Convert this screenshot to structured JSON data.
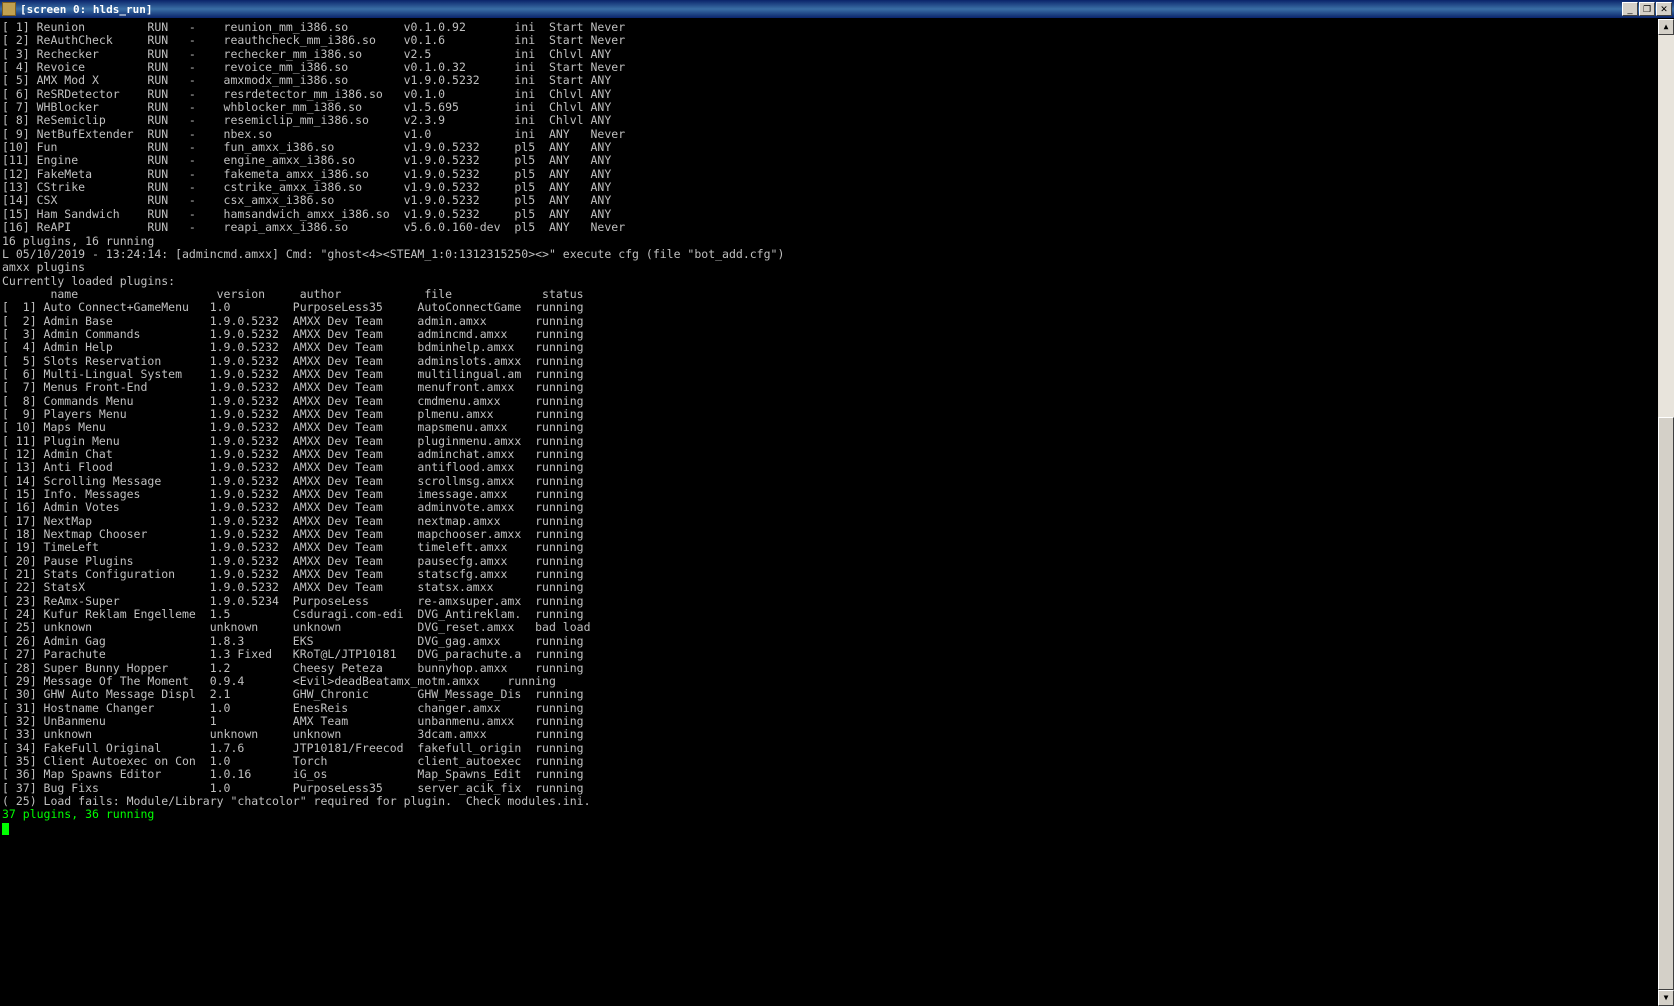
{
  "window": {
    "title": "[screen 0: hlds_run]"
  },
  "meta_list": [
    {
      "idx": " 1",
      "name": "Reunion",
      "stat": "RUN",
      "dash": "-",
      "file": "reunion_mm_i386.so",
      "ver": "v0.1.0.92",
      "src": "ini",
      "load": "Start",
      "unl": "Never"
    },
    {
      "idx": " 2",
      "name": "ReAuthCheck",
      "stat": "RUN",
      "dash": "-",
      "file": "reauthcheck_mm_i386.so",
      "ver": "v0.1.6",
      "src": "ini",
      "load": "Start",
      "unl": "Never"
    },
    {
      "idx": " 3",
      "name": "Rechecker",
      "stat": "RUN",
      "dash": "-",
      "file": "rechecker_mm_i386.so",
      "ver": "v2.5",
      "src": "ini",
      "load": "Chlvl",
      "unl": "ANY"
    },
    {
      "idx": " 4",
      "name": "Revoice",
      "stat": "RUN",
      "dash": "-",
      "file": "revoice_mm_i386.so",
      "ver": "v0.1.0.32",
      "src": "ini",
      "load": "Start",
      "unl": "Never"
    },
    {
      "idx": " 5",
      "name": "AMX Mod X",
      "stat": "RUN",
      "dash": "-",
      "file": "amxmodx_mm_i386.so",
      "ver": "v1.9.0.5232",
      "src": "ini",
      "load": "Start",
      "unl": "ANY"
    },
    {
      "idx": " 6",
      "name": "ReSRDetector",
      "stat": "RUN",
      "dash": "-",
      "file": "resrdetector_mm_i386.so",
      "ver": "v0.1.0",
      "src": "ini",
      "load": "Chlvl",
      "unl": "ANY"
    },
    {
      "idx": " 7",
      "name": "WHBlocker",
      "stat": "RUN",
      "dash": "-",
      "file": "whblocker_mm_i386.so",
      "ver": "v1.5.695",
      "src": "ini",
      "load": "Chlvl",
      "unl": "ANY"
    },
    {
      "idx": " 8",
      "name": "ReSemiclip",
      "stat": "RUN",
      "dash": "-",
      "file": "resemiclip_mm_i386.so",
      "ver": "v2.3.9",
      "src": "ini",
      "load": "Chlvl",
      "unl": "ANY"
    },
    {
      "idx": " 9",
      "name": "NetBufExtender",
      "stat": "RUN",
      "dash": "-",
      "file": "nbex.so",
      "ver": "v1.0",
      "src": "ini",
      "load": "ANY",
      "unl": "Never"
    },
    {
      "idx": "10",
      "name": "Fun",
      "stat": "RUN",
      "dash": "-",
      "file": "fun_amxx_i386.so",
      "ver": "v1.9.0.5232",
      "src": "pl5",
      "load": "ANY",
      "unl": "ANY"
    },
    {
      "idx": "11",
      "name": "Engine",
      "stat": "RUN",
      "dash": "-",
      "file": "engine_amxx_i386.so",
      "ver": "v1.9.0.5232",
      "src": "pl5",
      "load": "ANY",
      "unl": "ANY"
    },
    {
      "idx": "12",
      "name": "FakeMeta",
      "stat": "RUN",
      "dash": "-",
      "file": "fakemeta_amxx_i386.so",
      "ver": "v1.9.0.5232",
      "src": "pl5",
      "load": "ANY",
      "unl": "ANY"
    },
    {
      "idx": "13",
      "name": "CStrike",
      "stat": "RUN",
      "dash": "-",
      "file": "cstrike_amxx_i386.so",
      "ver": "v1.9.0.5232",
      "src": "pl5",
      "load": "ANY",
      "unl": "ANY"
    },
    {
      "idx": "14",
      "name": "CSX",
      "stat": "RUN",
      "dash": "-",
      "file": "csx_amxx_i386.so",
      "ver": "v1.9.0.5232",
      "src": "pl5",
      "load": "ANY",
      "unl": "ANY"
    },
    {
      "idx": "15",
      "name": "Ham Sandwich",
      "stat": "RUN",
      "dash": "-",
      "file": "hamsandwich_amxx_i386.so",
      "ver": "v1.9.0.5232",
      "src": "pl5",
      "load": "ANY",
      "unl": "ANY"
    },
    {
      "idx": "16",
      "name": "ReAPI",
      "stat": "RUN",
      "dash": "-",
      "file": "reapi_amxx_i386.so",
      "ver": "v5.6.0.160-dev",
      "src": "pl5",
      "load": "ANY",
      "unl": "Never"
    }
  ],
  "meta_summary": "16 plugins, 16 running",
  "log_line": "L 05/10/2019 - 13:24:14: [admincmd.amxx] Cmd: \"ghost<4><STEAM_1:0:1312315250><>\" execute cfg (file \"bot_add.cfg\")",
  "amxx_cmd": "amxx plugins",
  "amxx_loaded": "Currently loaded plugins:",
  "amxx_header": {
    "name": "name",
    "version": "version",
    "author": "author",
    "file": "file",
    "status": "status"
  },
  "amxx_list": [
    {
      "idx": "  1",
      "name": "Auto Connect+GameMenu",
      "ver": "1.0",
      "author": "PurposeLess35",
      "file": "AutoConnectGame",
      "status": "running"
    },
    {
      "idx": "  2",
      "name": "Admin Base",
      "ver": "1.9.0.5232",
      "author": "AMXX Dev Team",
      "file": "admin.amxx",
      "status": "running"
    },
    {
      "idx": "  3",
      "name": "Admin Commands",
      "ver": "1.9.0.5232",
      "author": "AMXX Dev Team",
      "file": "admincmd.amxx",
      "status": "running"
    },
    {
      "idx": "  4",
      "name": "Admin Help",
      "ver": "1.9.0.5232",
      "author": "AMXX Dev Team",
      "file": "bdminhelp.amxx",
      "status": "running"
    },
    {
      "idx": "  5",
      "name": "Slots Reservation",
      "ver": "1.9.0.5232",
      "author": "AMXX Dev Team",
      "file": "adminslots.amxx",
      "status": "running"
    },
    {
      "idx": "  6",
      "name": "Multi-Lingual System",
      "ver": "1.9.0.5232",
      "author": "AMXX Dev Team",
      "file": "multilingual.am",
      "status": "running"
    },
    {
      "idx": "  7",
      "name": "Menus Front-End",
      "ver": "1.9.0.5232",
      "author": "AMXX Dev Team",
      "file": "menufront.amxx",
      "status": "running"
    },
    {
      "idx": "  8",
      "name": "Commands Menu",
      "ver": "1.9.0.5232",
      "author": "AMXX Dev Team",
      "file": "cmdmenu.amxx",
      "status": "running"
    },
    {
      "idx": "  9",
      "name": "Players Menu",
      "ver": "1.9.0.5232",
      "author": "AMXX Dev Team",
      "file": "plmenu.amxx",
      "status": "running"
    },
    {
      "idx": " 10",
      "name": "Maps Menu",
      "ver": "1.9.0.5232",
      "author": "AMXX Dev Team",
      "file": "mapsmenu.amxx",
      "status": "running"
    },
    {
      "idx": " 11",
      "name": "Plugin Menu",
      "ver": "1.9.0.5232",
      "author": "AMXX Dev Team",
      "file": "pluginmenu.amxx",
      "status": "running"
    },
    {
      "idx": " 12",
      "name": "Admin Chat",
      "ver": "1.9.0.5232",
      "author": "AMXX Dev Team",
      "file": "adminchat.amxx",
      "status": "running"
    },
    {
      "idx": " 13",
      "name": "Anti Flood",
      "ver": "1.9.0.5232",
      "author": "AMXX Dev Team",
      "file": "antiflood.amxx",
      "status": "running"
    },
    {
      "idx": " 14",
      "name": "Scrolling Message",
      "ver": "1.9.0.5232",
      "author": "AMXX Dev Team",
      "file": "scrollmsg.amxx",
      "status": "running"
    },
    {
      "idx": " 15",
      "name": "Info. Messages",
      "ver": "1.9.0.5232",
      "author": "AMXX Dev Team",
      "file": "imessage.amxx",
      "status": "running"
    },
    {
      "idx": " 16",
      "name": "Admin Votes",
      "ver": "1.9.0.5232",
      "author": "AMXX Dev Team",
      "file": "adminvote.amxx",
      "status": "running"
    },
    {
      "idx": " 17",
      "name": "NextMap",
      "ver": "1.9.0.5232",
      "author": "AMXX Dev Team",
      "file": "nextmap.amxx",
      "status": "running"
    },
    {
      "idx": " 18",
      "name": "Nextmap Chooser",
      "ver": "1.9.0.5232",
      "author": "AMXX Dev Team",
      "file": "mapchooser.amxx",
      "status": "running"
    },
    {
      "idx": " 19",
      "name": "TimeLeft",
      "ver": "1.9.0.5232",
      "author": "AMXX Dev Team",
      "file": "timeleft.amxx",
      "status": "running"
    },
    {
      "idx": " 20",
      "name": "Pause Plugins",
      "ver": "1.9.0.5232",
      "author": "AMXX Dev Team",
      "file": "pausecfg.amxx",
      "status": "running"
    },
    {
      "idx": " 21",
      "name": "Stats Configuration",
      "ver": "1.9.0.5232",
      "author": "AMXX Dev Team",
      "file": "statscfg.amxx",
      "status": "running"
    },
    {
      "idx": " 22",
      "name": "StatsX",
      "ver": "1.9.0.5232",
      "author": "AMXX Dev Team",
      "file": "statsx.amxx",
      "status": "running"
    },
    {
      "idx": " 23",
      "name": "ReAmx-Super",
      "ver": "1.9.0.5234",
      "author": "PurposeLess",
      "file": "re-amxsuper.amx",
      "status": "running"
    },
    {
      "idx": " 24",
      "name": "Kufur Reklam Engelleme",
      "ver": "1.5",
      "author": "Csduragi.com-edi",
      "file": "DVG_Antireklam.",
      "status": "running"
    },
    {
      "idx": " 25",
      "name": "unknown",
      "ver": "unknown",
      "author": "unknown",
      "file": "DVG_reset.amxx",
      "status": "bad load"
    },
    {
      "idx": " 26",
      "name": "Admin Gag",
      "ver": "1.8.3",
      "author": "EKS",
      "file": "DVG_gag.amxx",
      "status": "running"
    },
    {
      "idx": " 27",
      "name": "Parachute",
      "ver": "1.3 Fixed",
      "author": "KRoT@L/JTP10181",
      "file": "DVG_parachute.a",
      "status": "running"
    },
    {
      "idx": " 28",
      "name": "Super Bunny Hopper",
      "ver": "1.2",
      "author": "Cheesy Peteza",
      "file": "bunnyhop.amxx",
      "status": "running"
    },
    {
      "idx": " 29",
      "name": "Message Of The Moment",
      "ver": "0.9.4",
      "author": "<Evil>deadBeat",
      "file": "amx_motm.amxx",
      "status": "running"
    },
    {
      "idx": " 30",
      "name": "GHW Auto Message Displ",
      "ver": "2.1",
      "author": "GHW_Chronic",
      "file": "GHW_Message_Dis",
      "status": "running"
    },
    {
      "idx": " 31",
      "name": "Hostname Changer",
      "ver": "1.0",
      "author": "EnesReis",
      "file": "changer.amxx",
      "status": "running"
    },
    {
      "idx": " 32",
      "name": "UnBanmenu",
      "ver": "1",
      "author": "AMX Team",
      "file": "unbanmenu.amxx",
      "status": "running"
    },
    {
      "idx": " 33",
      "name": "unknown",
      "ver": "unknown",
      "author": "unknown",
      "file": "3dcam.amxx",
      "status": "running"
    },
    {
      "idx": " 34",
      "name": "FakeFull Original",
      "ver": "1.7.6",
      "author": "JTP10181/Freecod",
      "file": "fakefull_origin",
      "status": "running"
    },
    {
      "idx": " 35",
      "name": "Client Autoexec on Con",
      "ver": "1.0",
      "author": "Torch",
      "file": "client_autoexec",
      "status": "running"
    },
    {
      "idx": " 36",
      "name": "Map Spawns Editor",
      "ver": "1.0.16",
      "author": "iG_os",
      "file": "Map_Spawns_Edit",
      "status": "running"
    },
    {
      "idx": " 37",
      "name": "Bug Fixs",
      "ver": "1.0",
      "author": "PurposeLess35",
      "file": "server_acik_fix",
      "status": "running"
    }
  ],
  "load_fail": "( 25) Load fails: Module/Library \"chatcolor\" required for plugin.  Check modules.ini.",
  "amxx_summary": "37 plugins, 36 running"
}
